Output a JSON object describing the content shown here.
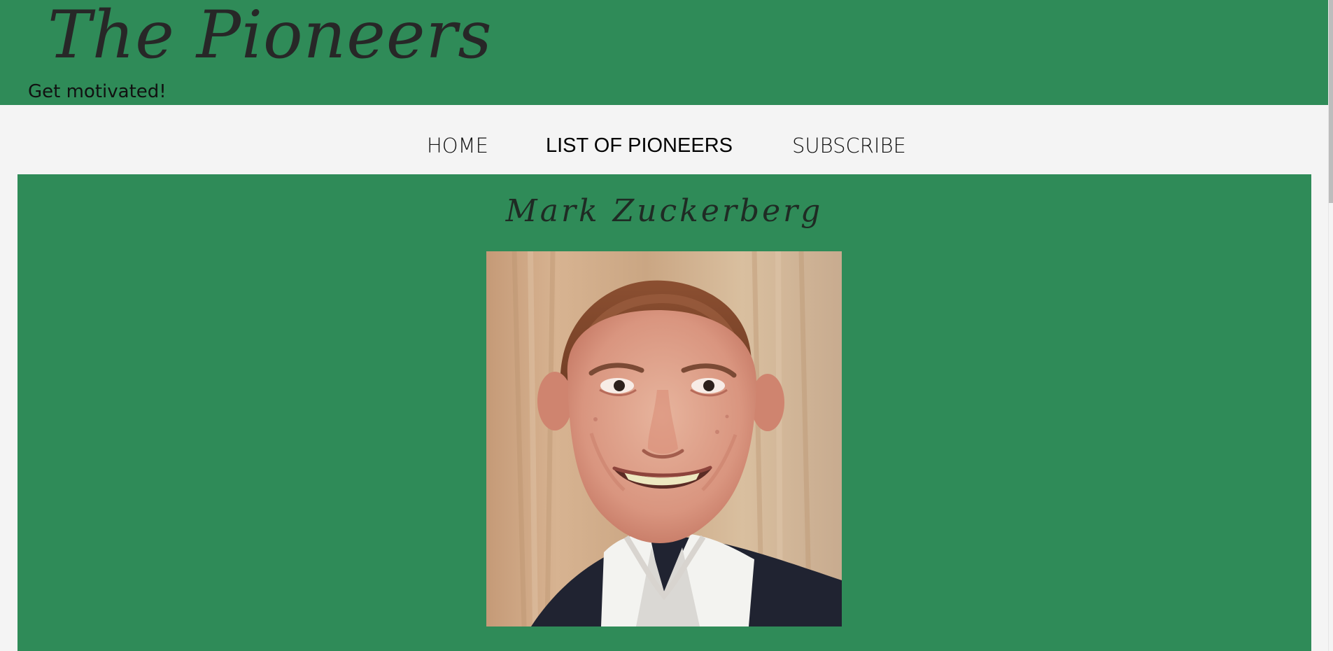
{
  "header": {
    "title": "The Pioneers",
    "tagline": "Get motivated!"
  },
  "nav": {
    "items": [
      {
        "label": "HOME"
      },
      {
        "label": "LIST OF PIONEERS"
      },
      {
        "label": "SUBSCRIBE"
      }
    ]
  },
  "pioneer": {
    "name": "Mark Zuckerberg"
  },
  "theme": {
    "primary": "#2f8b58",
    "page_background": "#f4f4f4",
    "text_dark": "#272727"
  }
}
